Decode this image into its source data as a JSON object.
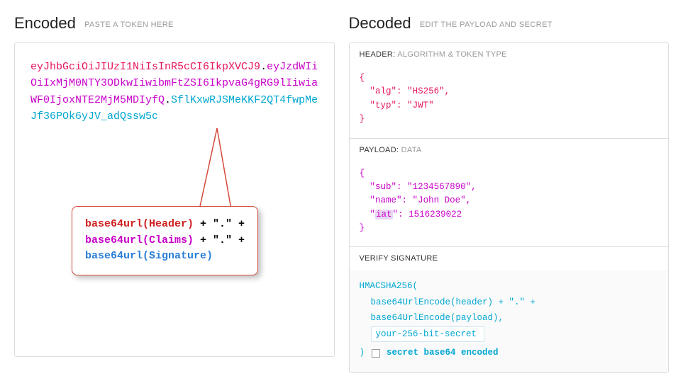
{
  "encoded": {
    "title": "Encoded",
    "subtitle": "PASTE A TOKEN HERE",
    "token_header": "eyJhbGciOiJIUzI1NiIsInR5cCI6IkpXVCJ9",
    "token_payload": "eyJzdWIiOiIxMjM0NTY3ODkwIiwibmFtZSI6IkpvaG4gRG9lIiwiaWF0IjoxNTE2MjM5MDIyfQ",
    "token_signature": "SflKxwRJSMeKKF2QT4fwpMeJf36POk6yJV_adQssw5c"
  },
  "callout": {
    "line1_prefix": "base64url(Header)",
    "line1_suffix": " + \".\" +",
    "line2_prefix": "base64url(Claims)",
    "line2_suffix": " + \".\" +",
    "line3": "base64url(Signature)"
  },
  "decoded": {
    "title": "Decoded",
    "subtitle": "EDIT THE PAYLOAD AND SECRET",
    "header_section": {
      "label_main": "HEADER:",
      "label_sub": "ALGORITHM & TOKEN TYPE",
      "json": {
        "alg": "HS256",
        "typ": "JWT"
      }
    },
    "payload_section": {
      "label_main": "PAYLOAD:",
      "label_sub": "DATA",
      "json": {
        "sub": "1234567890",
        "name": "John Doe",
        "iat": 1516239022
      }
    },
    "signature_section": {
      "label_main": "VERIFY SIGNATURE",
      "func": "HMACSHA256(",
      "line1": "base64UrlEncode(header) + \".\" +",
      "line2": "base64UrlEncode(payload),",
      "secret_value": "your-256-bit-secret",
      "close_paren": ")",
      "checkbox_label": "secret base64 encoded"
    }
  }
}
